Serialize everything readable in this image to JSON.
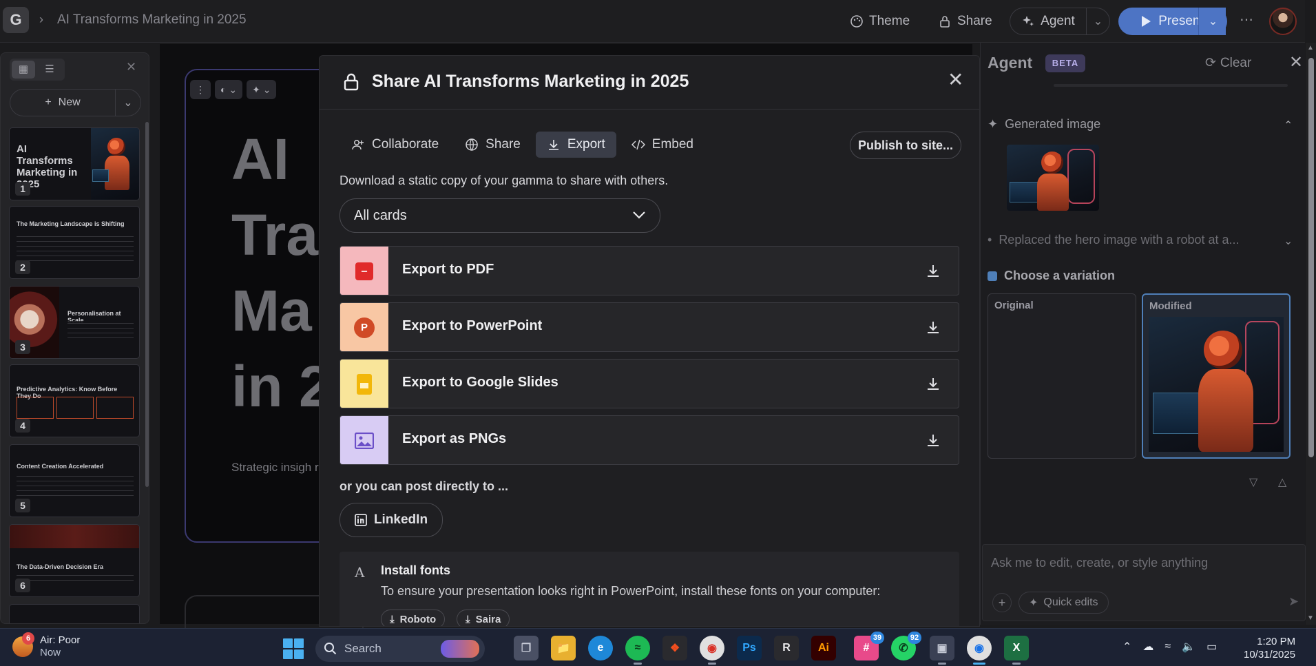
{
  "topbar": {
    "logo": "G",
    "doc_title": "AI Transforms Marketing in 2025",
    "theme_label": "Theme",
    "share_label": "Share",
    "agent_label": "Agent",
    "present_label": "Present"
  },
  "sidebar": {
    "new_label": "New",
    "thumbnails": [
      {
        "num": "1",
        "title": "AI Transforms Marketing in 2025"
      },
      {
        "num": "2",
        "title": "The Marketing Landscape is Shifting"
      },
      {
        "num": "3",
        "title": "Personalisation at Scale"
      },
      {
        "num": "4",
        "title": "Predictive Analytics: Know Before They Do"
      },
      {
        "num": "5",
        "title": "Content Creation Accelerated"
      },
      {
        "num": "6",
        "title": "The Data-Driven Decision Era"
      }
    ]
  },
  "slide": {
    "big_lines": [
      "AI",
      "Tra",
      "Ma",
      "in 2"
    ],
    "subtitle": "Strategic insigh revolution"
  },
  "modal": {
    "title": "Share AI Transforms Marketing in 2025",
    "tabs": [
      {
        "label": "Collaborate",
        "icon": "add-user-icon"
      },
      {
        "label": "Share",
        "icon": "globe-icon"
      },
      {
        "label": "Export",
        "icon": "download-icon",
        "active": true
      },
      {
        "label": "Embed",
        "icon": "code-icon"
      }
    ],
    "publish_label": "Publish to site...",
    "description": "Download a static copy of your gamma to share with others.",
    "select_value": "All cards",
    "exports": [
      {
        "label": "Export to PDF",
        "icon": "pdf-icon",
        "color": "#f5b8bd",
        "icon_color": "#e02a2a"
      },
      {
        "label": "Export to PowerPoint",
        "icon": "powerpoint-icon",
        "color": "#f8c7a4",
        "icon_color": "#d04a26"
      },
      {
        "label": "Export to Google Slides",
        "icon": "google-slides-icon",
        "color": "#f9e59a",
        "icon_color": "#f2b70a"
      },
      {
        "label": "Export as PNGs",
        "icon": "image-icon",
        "color": "#d8ccf4",
        "icon_color": "#6b4fc8"
      }
    ],
    "post_label": "or you can post directly to ...",
    "linkedin_label": "LinkedIn",
    "fonts": {
      "icon_letter": "A",
      "title": "Install fonts",
      "description": "To ensure your presentation looks right in PowerPoint, install these fonts on your computer:",
      "chips": [
        "Roboto",
        "Saira"
      ]
    }
  },
  "agent": {
    "title": "Agent",
    "beta": "BETA",
    "clear_label": "Clear",
    "generated_label": "Generated image",
    "replaced_text": "Replaced the hero image with a robot at a...",
    "choose_label": "Choose a variation",
    "original_label": "Original",
    "modified_label": "Modified",
    "input_placeholder": "Ask me to edit, create, or style anything",
    "quick_edits_label": "Quick edits"
  },
  "taskbar": {
    "weather_title": "Air: Poor",
    "weather_sub": "Now",
    "weather_badge": "6",
    "search_label": "Search",
    "slack_badge": "39",
    "whatsapp_badge": "92",
    "time": "1:20 PM",
    "date": "10/31/2025"
  }
}
